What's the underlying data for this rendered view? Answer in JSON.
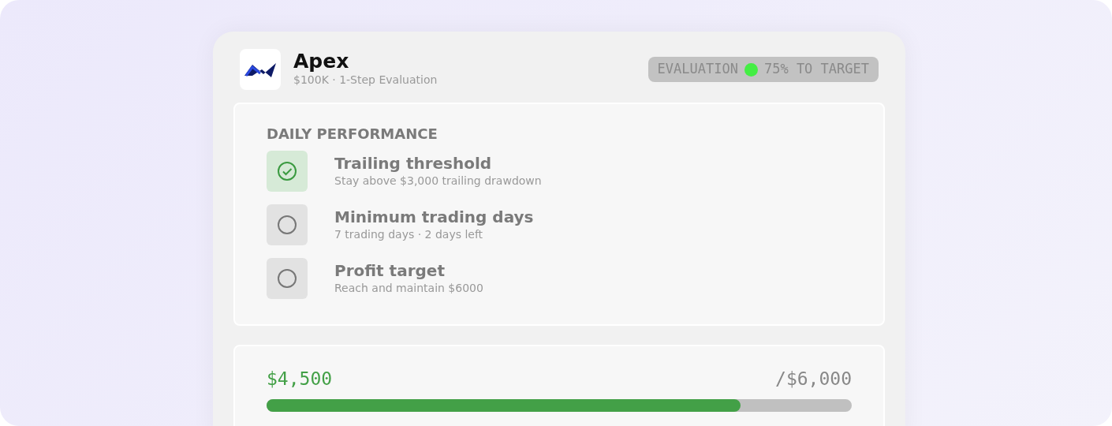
{
  "header": {
    "title": "Apex",
    "subtitle": "$100K · 1-Step Evaluation",
    "status": {
      "label": "EVALUATION",
      "text": "75% TO TARGET",
      "color": "#44ee44"
    }
  },
  "performance": {
    "title": "DAILY PERFORMANCE",
    "rules": [
      {
        "title": "Trailing threshold",
        "detail": "Stay above $3,000 trailing drawdown",
        "checked": true
      },
      {
        "title": "Minimum trading days",
        "detail": "7 trading days · 2 days left",
        "checked": false
      },
      {
        "title": "Profit target",
        "detail": "Reach and maintain $6000",
        "checked": false
      }
    ]
  },
  "progress": {
    "current": "$4,500",
    "target": "/$6,000",
    "level": 0.81
  }
}
